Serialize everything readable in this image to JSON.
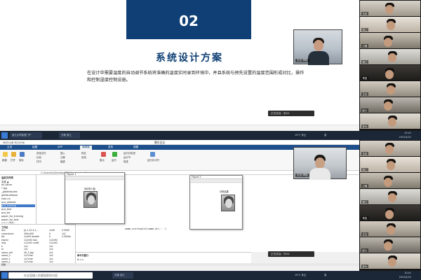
{
  "top": {
    "slide": {
      "number": "02",
      "heading": "系统设计方案",
      "body": "在设计中需要温度的自动调节系统将准确的温度实时录到环境中，并且系统与预先设置的温度范围形成对比，操作和控制湿度控制设施。",
      "camera_name": "王石·李四",
      "speaking": "正在讲话：张XX"
    },
    "taskbar": {
      "items": [
        "浙江大学智慧门户",
        "万维·浙江"
      ],
      "tray_text": "中",
      "lang": "英",
      "weather": "19°C 多云",
      "time": "10:41",
      "date": "2022/4/22"
    },
    "participants": [
      "王石",
      "刘二",
      "小明",
      "张三",
      "李四",
      "王五",
      "赵六",
      "孙七"
    ]
  },
  "bottom": {
    "matlab": {
      "app_title": "MATLAB R2019b",
      "center_title": "腾讯会议",
      "tabs": [
        "主页",
        "绘图",
        "APP",
        "编辑器",
        "发布",
        "视图"
      ],
      "ribbon": {
        "new": "新建",
        "open": "打开",
        "save": "保存",
        "find_files": "查找文件",
        "compare": "比较",
        "print": "打印",
        "insert": "插入",
        "comment": "注释",
        "indent": "缩进",
        "go_to": "转至",
        "find": "查找",
        "breakpoints": "断点",
        "run": "运行",
        "run_advance": "运行并前进",
        "run_section": "运行节",
        "advance": "前进",
        "run_time": "运行并计时"
      },
      "path": "C:\\Users\\lo\\Desktop\\PCA-face-recognition",
      "files_header": "当前文件夹",
      "files": [
        "名称 ▲",
        "orl_faces",
        "*.jpg",
        "_gitattributes",
        "getFaceName",
        "main.m",
        "pca_dataset",
        "pca_training",
        "pca_test",
        "pca_txt",
        "paper_for_training",
        "paper_for_test",
        "pca.m (脚本)"
      ],
      "selected_file_index": 7,
      "workspace_header": "工作区",
      "workspace": [
        {
          "name": "ans",
          "value": "[a,1,10,4,1...",
          "min": "1x40",
          "max": "0.5000"
        },
        {
          "name": "covariance",
          "value": "400x400",
          "min": "0",
          "max": "1x1"
        },
        {
          "name": "dis",
          "value": "1x400 double",
          "min": "0",
          "max": "2.5000e"
        },
        {
          "name": "eigval",
          "value": "112x92 dou",
          "min": "112x92",
          "max": ""
        },
        {
          "name": "img",
          "value": "112x92 uint8",
          "min": "112x92",
          "max": ""
        },
        {
          "name": "k",
          "value": "1x1",
          "min": "1x1",
          "max": ""
        },
        {
          "name": "m",
          "value": "1x1",
          "min": "1x1",
          "max": ""
        },
        {
          "name": "name_cell",
          "value": "40_5.jpg",
          "min": "1x1",
          "max": ""
        },
        {
          "name": "name_n",
          "value": "1x7char",
          "min": "1x1",
          "max": ""
        },
        {
          "name": "name_x",
          "value": "1x7char",
          "min": "1x1",
          "max": ""
        },
        {
          "name": "name_y",
          "value": "1x7char",
          "min": "1x1",
          "max": ""
        }
      ],
      "code": [
        "name_x=sprintf('%s',name(",
        "subplot(1,2,1)",
        "imshow(img)",
        "title('待识别人脸')",
        "subplot(1,2,2)",
        "imshow(train_name)",
        "title('识别结果')",
        "for  j=1:length(train_img)",
        "    ppdFile = sprintf(",
        "    tmp = readXXX(",
        "    name_x=strsplit(name_xl",
        "",
        "    name_x=strsplit(name_str,'.')"
      ],
      "cmd_header": "命令行窗口",
      "cmd_prompt": "fx >>",
      "status": "就绪",
      "speaking": "正在讲话：许XX",
      "camera_name": "王石·李四"
    },
    "figures": [
      {
        "title": "Figure 1",
        "caption": "待识别人脸"
      },
      {
        "title": "Figure 2",
        "caption": "识别结果"
      }
    ],
    "taskbar": {
      "search_placeholder": "在这里输入你要搜索的内容",
      "items": [
        "万维·浙江"
      ],
      "weather": "19°C 多云",
      "lang": "英",
      "time": "10:41",
      "date": "2022/4/22"
    },
    "participants": [
      "王石",
      "刘二",
      "小明",
      "张三",
      "李四",
      "王五",
      "赵六",
      "孙七"
    ]
  }
}
